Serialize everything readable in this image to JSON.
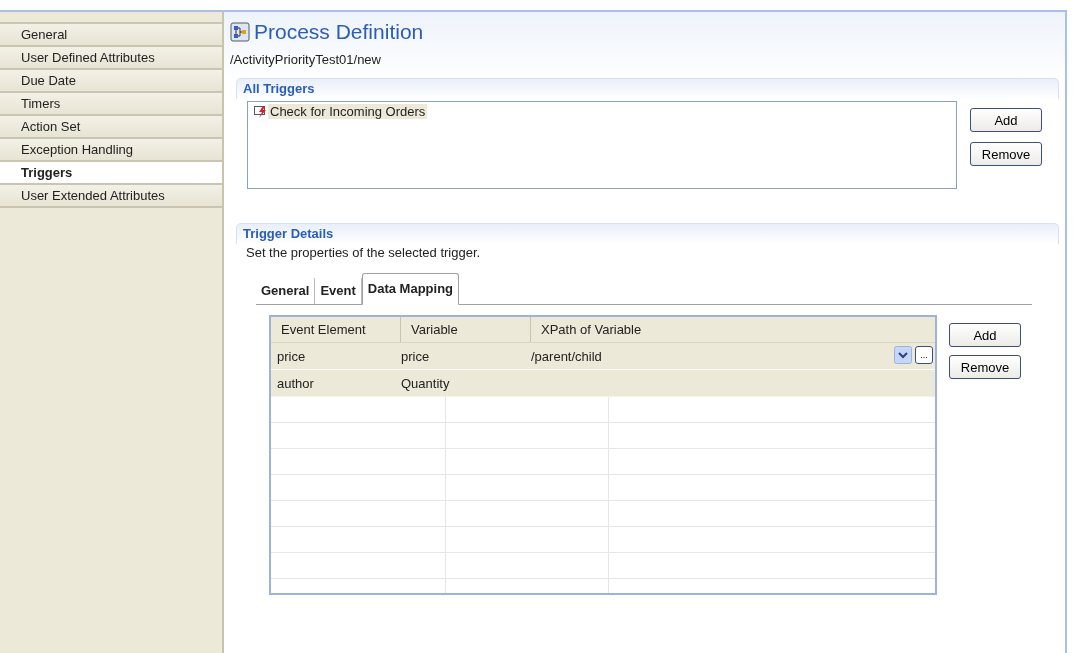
{
  "sidebar": {
    "items": [
      {
        "label": "General",
        "selected": false
      },
      {
        "label": "User Defined Attributes",
        "selected": false
      },
      {
        "label": "Due Date",
        "selected": false
      },
      {
        "label": "Timers",
        "selected": false
      },
      {
        "label": "Action Set",
        "selected": false
      },
      {
        "label": "Exception Handling",
        "selected": false
      },
      {
        "label": "Triggers",
        "selected": true
      },
      {
        "label": "User Extended Attributes",
        "selected": false
      }
    ]
  },
  "header": {
    "title": "Process Definition",
    "path": "/ActivityPriorityTest01/new"
  },
  "all_triggers": {
    "title": "All Triggers",
    "items": [
      {
        "label": "Check for Incoming Orders",
        "selected": true
      }
    ],
    "buttons": [
      "Add",
      "Remove"
    ]
  },
  "trigger_details": {
    "title": "Trigger Details",
    "description": "Set the properties of the selected trigger.",
    "tabs": [
      {
        "label": "General",
        "selected": false
      },
      {
        "label": "Event",
        "selected": false
      },
      {
        "label": "Data Mapping",
        "selected": true
      }
    ],
    "table": {
      "columns": [
        "Event Element",
        "Variable",
        "XPath of Variable"
      ],
      "rows": [
        {
          "cells": [
            "price",
            "price",
            "/parent/child"
          ],
          "editing": true,
          "browse_label": "..."
        },
        {
          "cells": [
            "author",
            "Quantity",
            ""
          ],
          "editing": false
        }
      ]
    },
    "buttons": [
      "Add",
      "Remove"
    ]
  }
}
